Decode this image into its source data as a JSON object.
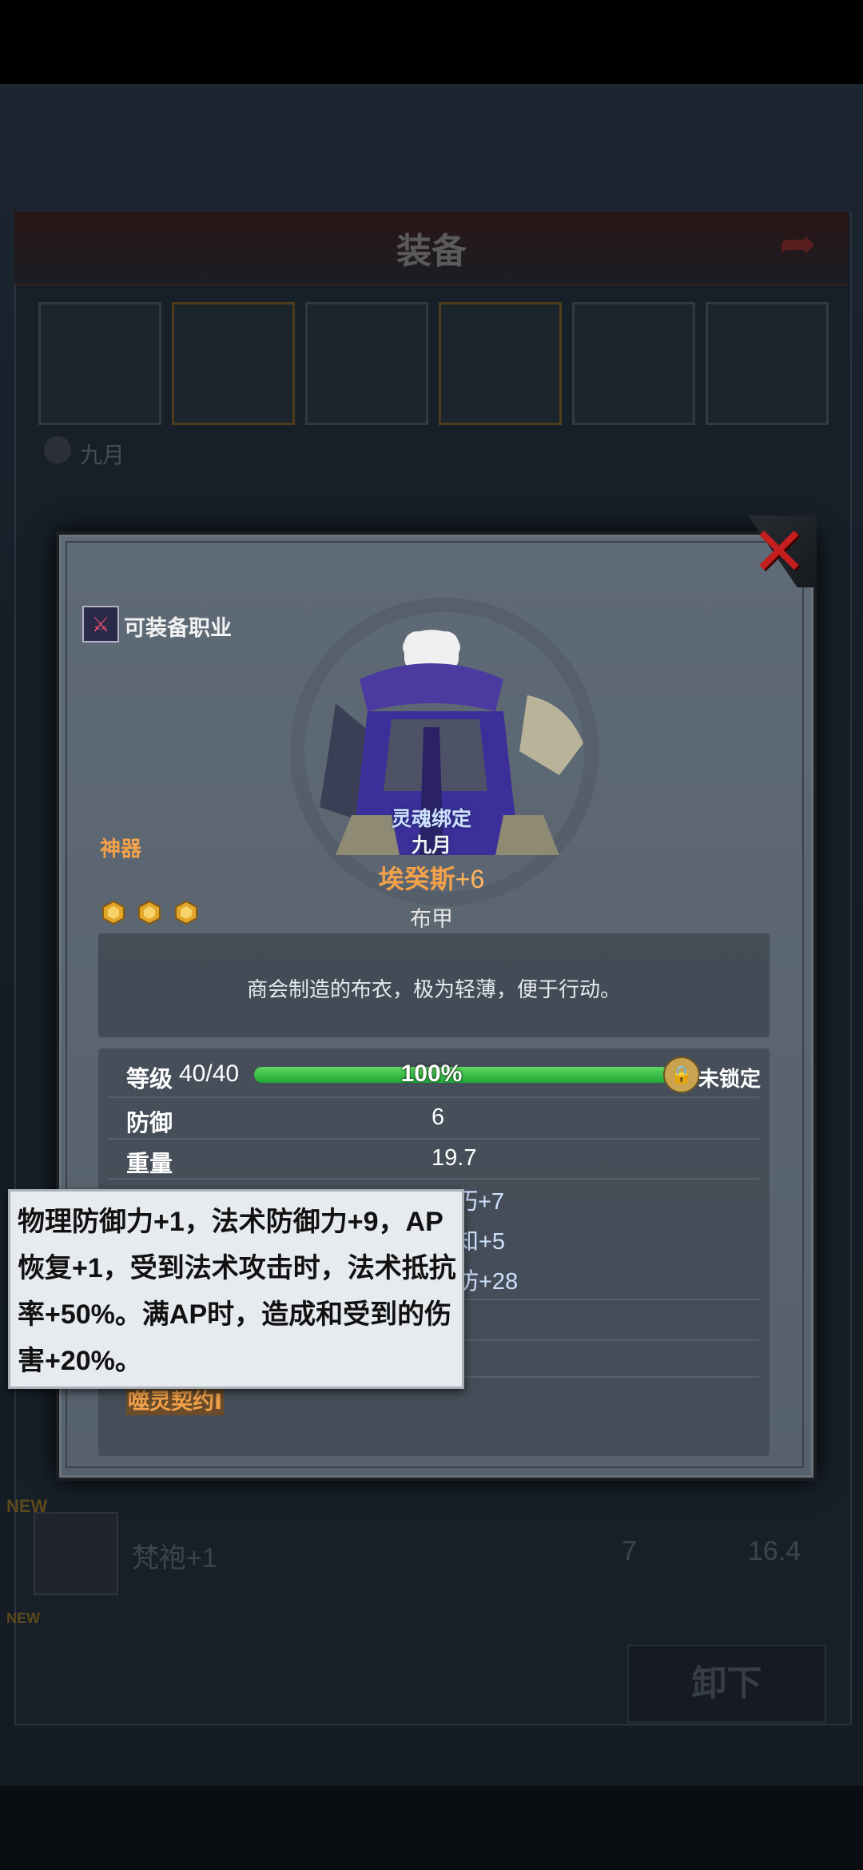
{
  "background": {
    "title": "装备",
    "owner": "九月",
    "new_badges": [
      "NEW",
      "NEW"
    ],
    "list_row": {
      "name": "梵袍+1",
      "value1": "7",
      "value2": "16.4"
    },
    "unequip_label": "卸下"
  },
  "modal": {
    "job_label": "可装备职业",
    "soul_bind": "灵魂绑定",
    "owner_name": "九月",
    "item_name": "埃癸斯",
    "item_plus": "+6",
    "item_type": "布甲",
    "rarity": "神器",
    "rarity_gems": 3,
    "description": "商会制造的布衣，极为轻薄，便于行动。",
    "level_label": "等级",
    "level_value": "40/40",
    "level_progress": 1.0,
    "level_percent": "100%",
    "lock_text": "未锁定",
    "stats": [
      {
        "label": "防御",
        "value": "6"
      },
      {
        "label": "重量",
        "value": "19.7"
      }
    ],
    "partial_right": [
      "技巧+7",
      "知+5",
      "坊+28"
    ],
    "contract": "噬灵契约Ⅰ"
  },
  "tooltip": {
    "text": "物理防御力+1，法术防御力+9，AP恢复+1，受到法术攻击时，法术抵抗率+50%。满AP时，造成和受到的伤害+20%。"
  },
  "colors": {
    "accent_orange": "#f2a14a",
    "progress_green": "#1fa63a",
    "close_red": "#c41e1e"
  }
}
